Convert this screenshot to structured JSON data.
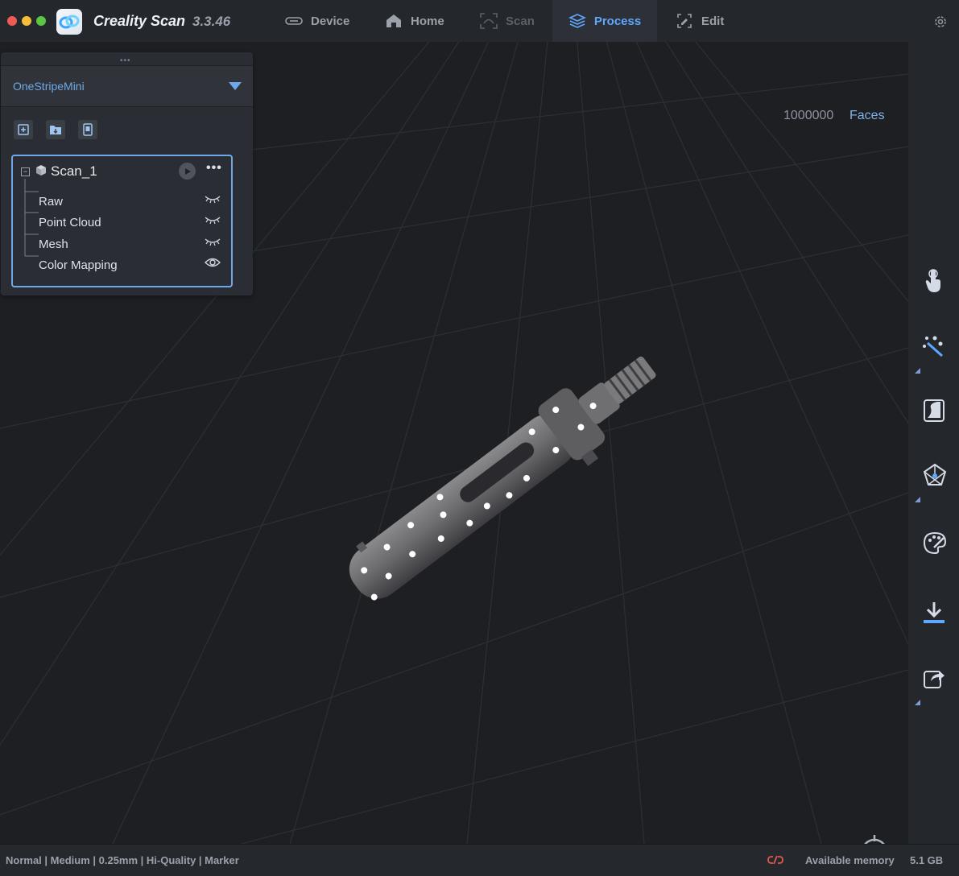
{
  "app": {
    "title": "Creality Scan",
    "version": "3.3.46"
  },
  "tabs": [
    {
      "label": "Device",
      "state": "normal"
    },
    {
      "label": "Home",
      "state": "normal"
    },
    {
      "label": "Scan",
      "state": "disabled"
    },
    {
      "label": "Process",
      "state": "active"
    },
    {
      "label": "Edit",
      "state": "normal"
    }
  ],
  "panel": {
    "device": "OneStripeMini",
    "toolbar_icons": [
      "new-project-icon",
      "open-folder-icon",
      "device-file-icon"
    ],
    "scan": {
      "name": "Scan_1",
      "items": [
        {
          "label": "Raw",
          "visibility": "hidden"
        },
        {
          "label": "Point Cloud",
          "visibility": "hidden"
        },
        {
          "label": "Mesh",
          "visibility": "hidden"
        },
        {
          "label": "Color Mapping",
          "visibility": "visible"
        }
      ]
    }
  },
  "viewport": {
    "faces_count": "1000000",
    "faces_label": "Faces"
  },
  "right_toolbar": [
    "hand-select-icon",
    "magic-wand-icon",
    "fill-holes-icon",
    "mesh-network-icon",
    "texture-palette-icon",
    "download-icon",
    "share-export-icon"
  ],
  "statusbar": {
    "settings": "Normal | Medium | 0.25mm | Hi-Quality | Marker",
    "memory_label": "Available memory",
    "memory_value": "5.1 GB"
  },
  "colors": {
    "accent": "#5ea8ff",
    "background": "#1c1e22",
    "panel": "#2a2d33"
  }
}
